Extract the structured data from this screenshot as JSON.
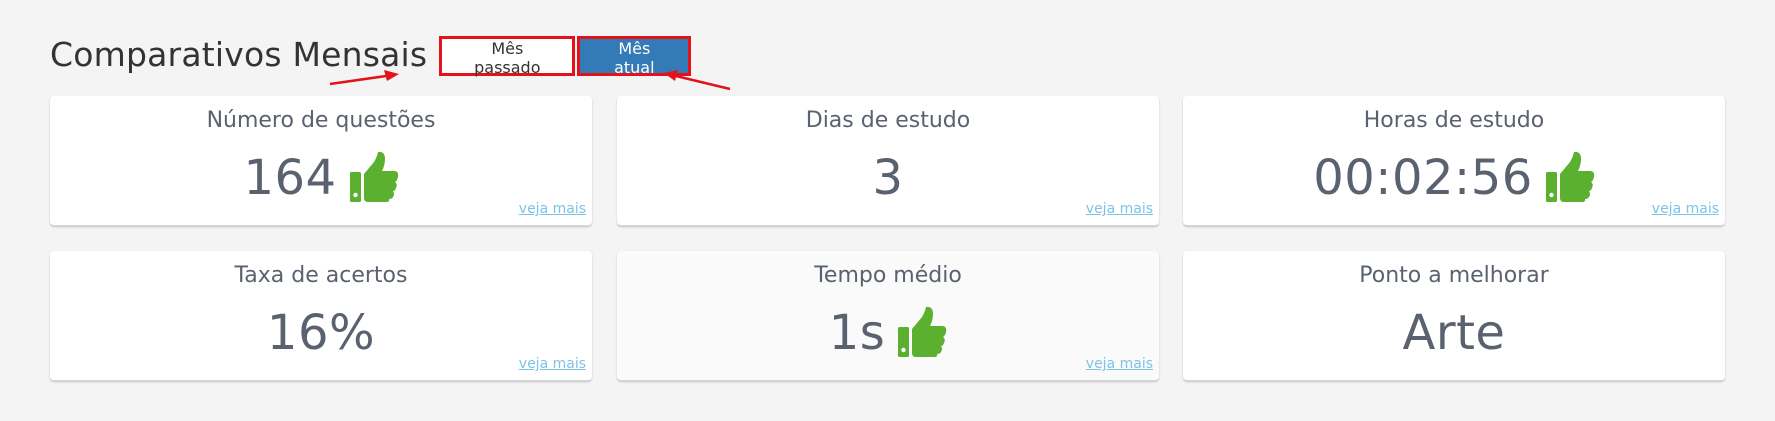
{
  "header": {
    "title": "Comparativos Mensais",
    "toggle": {
      "previous_label": "Mês passado",
      "current_label": "Mês atual",
      "active": "current"
    }
  },
  "cards": [
    {
      "title": "Número de questões",
      "value": "164",
      "icon": "thumbs-up-icon",
      "link": "veja mais"
    },
    {
      "title": "Dias de estudo",
      "value": "3",
      "icon": null,
      "link": "veja mais"
    },
    {
      "title": "Horas de estudo",
      "value": "00:02:56",
      "icon": "thumbs-up-icon",
      "link": "veja mais"
    },
    {
      "title": "Taxa de acertos",
      "value": "16%",
      "icon": null,
      "link": "veja mais"
    },
    {
      "title": "Tempo médio",
      "value": "1s",
      "icon": "thumbs-up-icon",
      "link": "veja mais"
    },
    {
      "title": "Ponto a melhorar",
      "value": "Arte",
      "icon": null,
      "link": null
    }
  ],
  "colors": {
    "accent": "#337ab7",
    "annotation": "#e0141a",
    "thumb": "#5bb12f",
    "link": "#7cc3e8"
  }
}
